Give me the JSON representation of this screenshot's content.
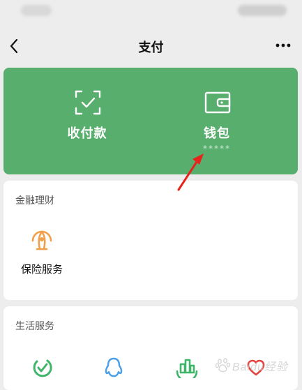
{
  "nav": {
    "title": "支付"
  },
  "card": {
    "pay_label": "收付款",
    "wallet_label": "钱包",
    "wallet_balance_masked": "*****",
    "background_color": "#57ae6d"
  },
  "finance": {
    "title": "金融理财",
    "items": [
      {
        "label": "保险服务",
        "icon": "insurance-umbrella-icon"
      }
    ]
  },
  "life": {
    "title": "生活服务",
    "items": [
      {
        "icon": "check-circle-icon"
      },
      {
        "icon": "qq-penguin-icon"
      },
      {
        "icon": "city-service-icon"
      },
      {
        "icon": "charity-heart-icon"
      }
    ]
  },
  "watermark": {
    "text": "Baidu经验",
    "logo": "baidu-paw-icon"
  }
}
